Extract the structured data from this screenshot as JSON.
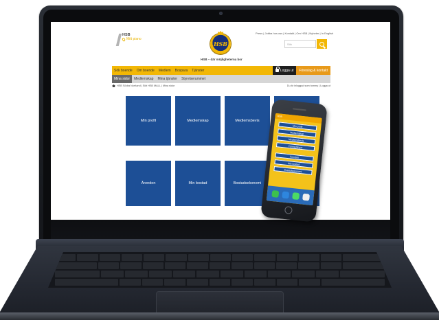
{
  "site": {
    "brand": "HSB",
    "location": "Mitt piano",
    "tagline": "HSB – där möjligheterna bor",
    "emblem_text": "HSB",
    "utility_links": "Press | Jobba hos oss | Kontakt | Om HSB | Nyheter | In English",
    "search_placeholder": "Sök",
    "search_icon": "search-icon"
  },
  "main_nav": {
    "items": [
      "Sök boende",
      "Om boende",
      "Medlem",
      "Bospara",
      "Tjänster"
    ],
    "login_label": "Logga ut",
    "member_label": "Föreslag & kontakt"
  },
  "sub_nav": {
    "items": [
      "Mina sidor",
      "Medlemskap",
      "Mina tjänster",
      "Styrelserummet"
    ],
    "active": "Mina sidor"
  },
  "breadcrumb": {
    "path": "HSB Södra Norrland | Sikt HSB MALL | Mina sidor",
    "logged_in": "Du är inloggad som tommy | Logga ut"
  },
  "tiles": [
    "Min profil",
    "Medlemskap",
    "Medlemsbevis",
    "",
    "Ärenden",
    "Min bostad",
    "Bostadsekonomi",
    ""
  ],
  "phone": {
    "status": "HSB",
    "menu": [
      "Min profil",
      "Medlemskap",
      "Medlemsbevis",
      "Förmedlingar",
      "Ärenden",
      "Min bostad",
      "Bostadsekonomi"
    ],
    "dock_apps": [
      {
        "name": "phone-app-icon",
        "color": "#3cc14d"
      },
      {
        "name": "safari-app-icon",
        "color": "#2e86de"
      },
      {
        "name": "messages-app-icon",
        "color": "#4cd964"
      },
      {
        "name": "music-app-icon",
        "color": "#f0f0f0"
      }
    ]
  },
  "colors": {
    "accent": "#f2b705",
    "tile_blue": "#1d4f96",
    "login_bg": "#1e1e1e",
    "member_bg": "#e89a1a"
  }
}
